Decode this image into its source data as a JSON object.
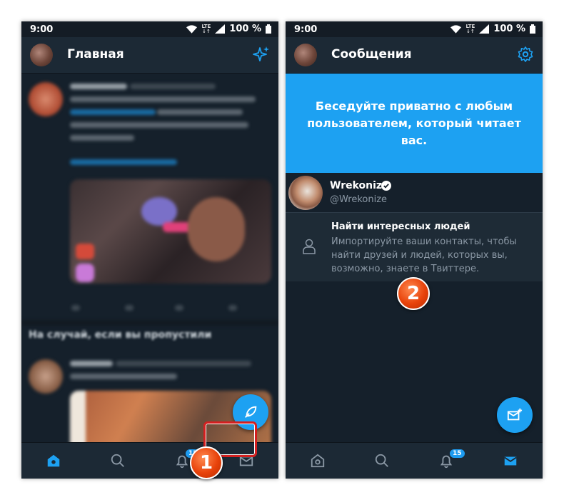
{
  "left_phone": {
    "status": {
      "time": "9:00",
      "network": "LTE",
      "battery": "100 %"
    },
    "header": {
      "title": "Главная"
    },
    "feed": {
      "section_heading": "На случай, если вы пропустили"
    },
    "nav": {
      "badge": "15"
    }
  },
  "right_phone": {
    "status": {
      "time": "9:00",
      "network": "LTE",
      "battery": "100 %"
    },
    "header": {
      "title": "Сообщения"
    },
    "promo": {
      "text": "Беседуйте приватно с любым пользователем, который читает вас."
    },
    "user": {
      "name": "Wrekonize",
      "handle": "@Wrekonize"
    },
    "suggestion": {
      "title": "Найти интересных людей",
      "description": "Импортируйте ваши контакты, чтобы найти друзей и людей, которых вы, возможно, знаете в Твиттере."
    },
    "nav": {
      "badge": "15"
    }
  },
  "annotations": {
    "step1": "1",
    "step2": "2"
  },
  "colors": {
    "accent": "#1da1f2",
    "background": "#15202b",
    "bar": "#1c2935",
    "highlight": "#d41f1f"
  }
}
